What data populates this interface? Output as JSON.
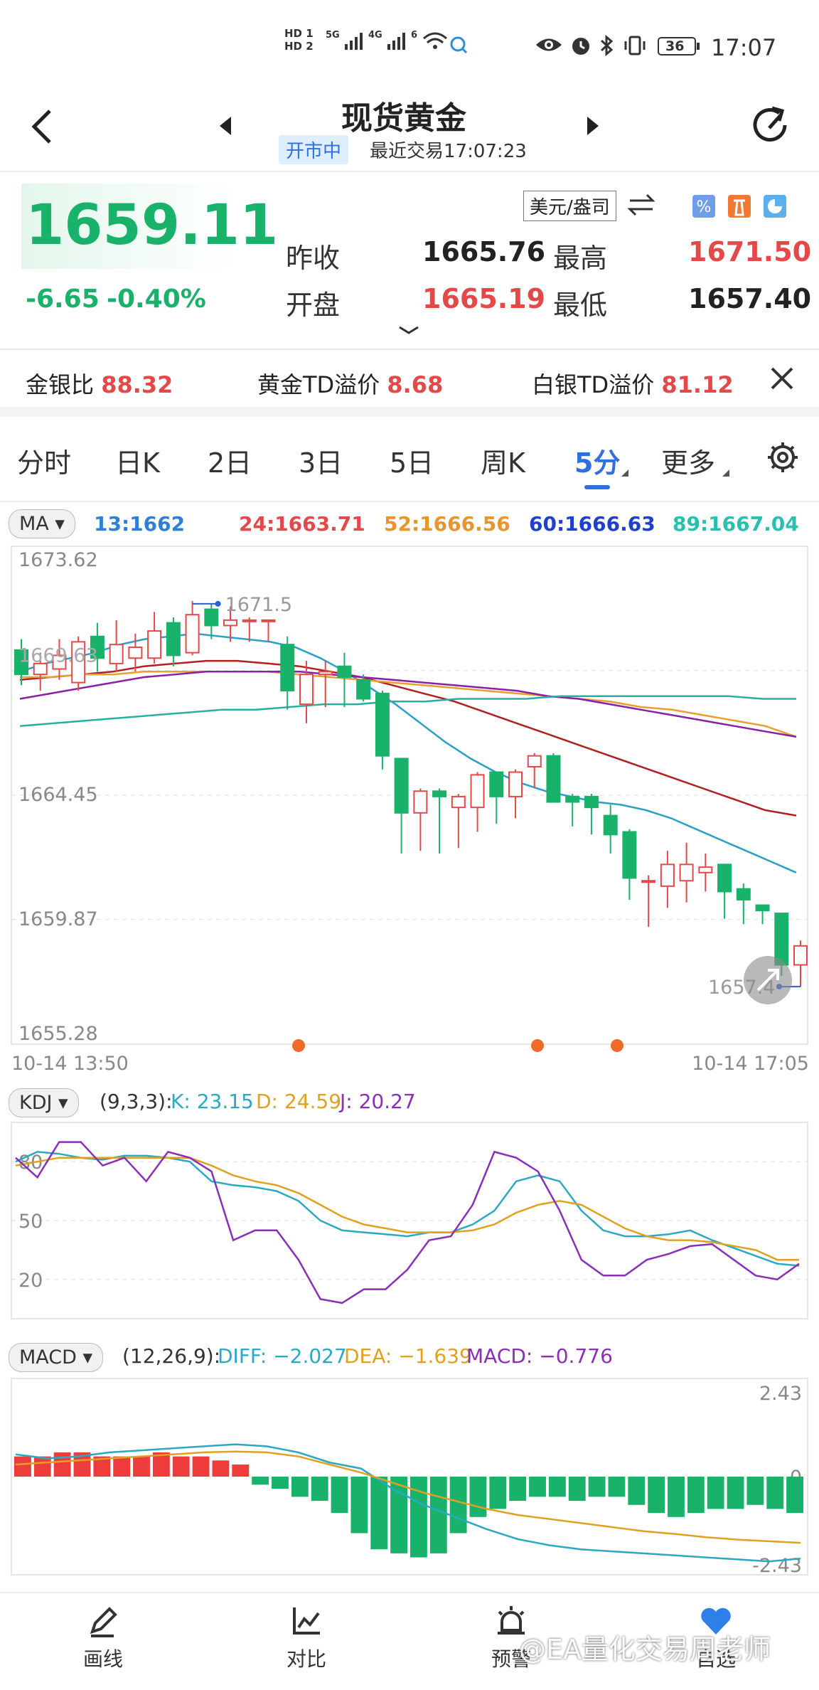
{
  "status_bar": {
    "hd1": "HD 1",
    "hd2": "HD 2",
    "net1": "5G",
    "net2": "4G",
    "net3": "6",
    "battery": "36",
    "time": "17:07"
  },
  "header": {
    "title": "现货黄金",
    "market_status": "开市中",
    "last_trade": "最近交易17:07:23"
  },
  "quote": {
    "price": "1659.11",
    "change": "-6.65",
    "change_pct": "-0.40%",
    "unit": "美元/盎司",
    "prev_close_label": "昨收",
    "prev_close": "1665.76",
    "high_label": "最高",
    "high": "1671.50",
    "open_label": "开盘",
    "open": "1665.19",
    "low_label": "最低",
    "low": "1657.40"
  },
  "ratios": {
    "gs_label": "金银比",
    "gs_value": "88.32",
    "gold_td_label": "黄金TD溢价",
    "gold_td_value": "8.68",
    "silver_td_label": "白银TD溢价",
    "silver_td_value": "81.12"
  },
  "tabs": [
    {
      "label": "分时"
    },
    {
      "label": "日K"
    },
    {
      "label": "2日"
    },
    {
      "label": "3日"
    },
    {
      "label": "5日"
    },
    {
      "label": "周K"
    },
    {
      "label": "5分",
      "active": true
    },
    {
      "label": "更多"
    }
  ],
  "ma": {
    "selector": "MA",
    "ma13": "13:1662",
    "ma24": "24:1663.71",
    "ma52": "52:1666.56",
    "ma60": "60:1666.63",
    "ma89": "89:1667.04"
  },
  "colors": {
    "up": "#e44949",
    "down": "#18b26b",
    "ma13": "#2aa0c8",
    "ma24": "#b0201f",
    "ma52": "#e5a030",
    "ma60": "#8a1fa8",
    "ma89": "#27b0a0"
  },
  "kdj": {
    "selector": "KDJ",
    "params": "(9,3,3):",
    "k": "K: 23.15",
    "d": "D: 24.59",
    "j": "J: 20.27"
  },
  "macd": {
    "selector": "MACD",
    "params": "(12,26,9):",
    "diff": "DIFF: −2.027",
    "dea": "DEA: −1.639",
    "macd": "MACD: −0.776"
  },
  "bottom_nav": [
    {
      "label": "画线"
    },
    {
      "label": "对比"
    },
    {
      "label": "预警"
    },
    {
      "label": "自选"
    }
  ],
  "watermark": "@EA量化交易周老师",
  "chart_data": [
    {
      "type": "candlestick",
      "title": "",
      "y_ticks": [
        "1673.62",
        "1664.45",
        "1659.87",
        "1655.28"
      ],
      "ylim": [
        1655.28,
        1673.62
      ],
      "x_labels": [
        "10-14 13:50",
        "10-14 17:05"
      ],
      "annotations": [
        {
          "text": "1671.5"
        },
        {
          "text": "1657.4"
        },
        {
          "text": "1669.63"
        }
      ],
      "candles": [
        [
          1669.8,
          1668.9,
          1670.2,
          1668.5
        ],
        [
          1668.9,
          1669.3,
          1669.7,
          1668.3
        ],
        [
          1669.1,
          1669.6,
          1670.2,
          1668.7
        ],
        [
          1668.6,
          1670.1,
          1670.3,
          1668.3
        ],
        [
          1670.3,
          1669.5,
          1670.8,
          1669.0
        ],
        [
          1669.3,
          1670.0,
          1670.9,
          1669.0
        ],
        [
          1669.5,
          1669.9,
          1670.4,
          1669.0
        ],
        [
          1669.5,
          1670.5,
          1671.2,
          1669.3
        ],
        [
          1670.8,
          1669.6,
          1671.0,
          1669.2
        ],
        [
          1669.7,
          1671.1,
          1671.6,
          1669.6
        ],
        [
          1671.3,
          1670.7,
          1671.5,
          1670.2
        ],
        [
          1670.7,
          1670.9,
          1671.4,
          1670.1
        ],
        [
          1670.9,
          1670.9,
          1671.0,
          1670.1
        ],
        [
          1670.9,
          1670.9,
          1670.9,
          1670.1
        ],
        [
          1670.0,
          1668.3,
          1670.3,
          1667.6
        ],
        [
          1667.8,
          1668.9,
          1669.4,
          1667.1
        ],
        [
          1668.9,
          1669.0,
          1669.4,
          1667.7
        ],
        [
          1669.2,
          1668.8,
          1669.7,
          1667.7
        ],
        [
          1668.7,
          1668.0,
          1668.9,
          1667.9
        ],
        [
          1668.2,
          1665.9,
          1668.3,
          1665.4
        ],
        [
          1665.8,
          1663.8,
          1665.4,
          1662.3
        ],
        [
          1663.8,
          1664.6,
          1664.7,
          1662.4
        ],
        [
          1664.6,
          1664.4,
          1664.7,
          1662.3
        ],
        [
          1664.0,
          1664.4,
          1664.5,
          1662.5
        ],
        [
          1664.0,
          1665.2,
          1665.3,
          1663.1
        ],
        [
          1665.3,
          1664.4,
          1665.2,
          1663.4
        ],
        [
          1664.4,
          1665.3,
          1665.4,
          1663.6
        ],
        [
          1665.5,
          1665.9,
          1666.0,
          1664.7
        ],
        [
          1665.9,
          1664.2,
          1666.0,
          1664.2
        ],
        [
          1664.4,
          1664.2,
          1664.5,
          1663.3
        ],
        [
          1664.4,
          1664.0,
          1664.5,
          1663.0
        ],
        [
          1663.7,
          1663.0,
          1664.1,
          1662.3
        ],
        [
          1663.1,
          1661.4,
          1663.2,
          1660.6
        ],
        [
          1661.3,
          1661.3,
          1661.5,
          1659.6
        ],
        [
          1661.1,
          1661.9,
          1662.4,
          1660.3
        ],
        [
          1661.3,
          1661.9,
          1662.7,
          1660.5
        ],
        [
          1661.6,
          1661.8,
          1662.3,
          1660.9
        ],
        [
          1661.9,
          1660.9,
          1661.9,
          1659.9
        ],
        [
          1661.0,
          1660.6,
          1661.2,
          1659.7
        ],
        [
          1660.4,
          1660.2,
          1660.4,
          1659.7
        ],
        [
          1660.1,
          1658.2,
          1660.0,
          1657.8
        ],
        [
          1658.2,
          1658.9,
          1659.1,
          1657.4
        ]
      ],
      "series": [
        {
          "name": "13",
          "values": [
            1669.0,
            1669.3,
            1669.5,
            1669.7,
            1670.0,
            1670.2,
            1670.3,
            1670.4,
            1670.3,
            1670.2,
            1670.1,
            1669.9,
            1669.5,
            1669.0,
            1668.4,
            1667.8,
            1667.1,
            1666.4,
            1665.8,
            1665.3,
            1664.9,
            1664.6,
            1664.4,
            1664.2,
            1664.1,
            1663.9,
            1663.6,
            1663.2,
            1662.8,
            1662.4,
            1662.0,
            1661.6
          ]
        },
        {
          "name": "24",
          "values": [
            1668.7,
            1668.8,
            1668.9,
            1669.0,
            1669.2,
            1669.3,
            1669.4,
            1669.4,
            1669.3,
            1669.2,
            1669.0,
            1668.8,
            1668.5,
            1668.2,
            1667.9,
            1667.5,
            1667.1,
            1666.7,
            1666.3,
            1665.9,
            1665.5,
            1665.1,
            1664.7,
            1664.3,
            1663.9,
            1663.7
          ]
        },
        {
          "name": "52",
          "values": [
            1668.8,
            1668.8,
            1668.9,
            1668.9,
            1669.0,
            1669.0,
            1669.0,
            1669.0,
            1669.0,
            1668.9,
            1668.8,
            1668.7,
            1668.6,
            1668.5,
            1668.4,
            1668.3,
            1668.2,
            1668.1,
            1668.0,
            1667.9,
            1667.7,
            1667.6,
            1667.4,
            1667.2,
            1667.0,
            1666.6
          ]
        },
        {
          "name": "60",
          "values": [
            1668.0,
            1668.2,
            1668.4,
            1668.6,
            1668.8,
            1668.9,
            1669.0,
            1669.0,
            1669.0,
            1669.0,
            1668.9,
            1668.8,
            1668.7,
            1668.6,
            1668.5,
            1668.4,
            1668.3,
            1668.1,
            1668.0,
            1667.8,
            1667.6,
            1667.4,
            1667.2,
            1667.0,
            1666.8,
            1666.6
          ]
        },
        {
          "name": "89",
          "values": [
            1667.0,
            1667.1,
            1667.2,
            1667.3,
            1667.4,
            1667.5,
            1667.6,
            1667.6,
            1667.7,
            1667.8,
            1667.8,
            1667.9,
            1667.9,
            1668.0,
            1668.0,
            1668.0,
            1668.1,
            1668.1,
            1668.1,
            1668.1,
            1668.1,
            1668.1,
            1668.0,
            1668.0
          ]
        }
      ]
    },
    {
      "type": "line",
      "title": "KDJ",
      "y_ticks": [
        "80",
        "50",
        "20"
      ],
      "ylim": [
        0,
        100
      ],
      "series": [
        {
          "name": "K",
          "values": [
            80,
            85,
            84,
            82,
            81,
            83,
            83,
            82,
            80,
            70,
            68,
            67,
            65,
            60,
            50,
            45,
            44,
            43,
            42,
            44,
            44,
            48,
            55,
            70,
            73,
            70,
            55,
            45,
            42,
            42,
            43,
            45,
            40,
            36,
            32,
            28,
            27
          ]
        },
        {
          "name": "D",
          "values": [
            78,
            80,
            82,
            82,
            82,
            82,
            82,
            82,
            82,
            78,
            73,
            70,
            68,
            64,
            58,
            52,
            48,
            46,
            44,
            44,
            44,
            45,
            48,
            54,
            58,
            60,
            58,
            52,
            46,
            42,
            40,
            40,
            39,
            37,
            35,
            30,
            30
          ]
        },
        {
          "name": "J",
          "values": [
            82,
            72,
            90,
            90,
            78,
            82,
            70,
            85,
            82,
            75,
            40,
            45,
            45,
            30,
            10,
            8,
            15,
            15,
            25,
            40,
            42,
            58,
            85,
            82,
            75,
            55,
            30,
            22,
            22,
            30,
            33,
            37,
            38,
            30,
            22,
            20,
            28
          ]
        }
      ]
    },
    {
      "type": "bar",
      "title": "MACD",
      "y_ticks": [
        "2.43",
        "0",
        "-2.43"
      ],
      "ylim": [
        -2.43,
        2.43
      ],
      "values": [
        0.5,
        0.5,
        0.6,
        0.6,
        0.5,
        0.5,
        0.5,
        0.6,
        0.5,
        0.5,
        0.4,
        0.3,
        -0.2,
        -0.3,
        -0.5,
        -0.6,
        -0.9,
        -1.4,
        -1.8,
        -1.9,
        -2.0,
        -1.9,
        -1.4,
        -1.0,
        -0.8,
        -0.6,
        -0.5,
        -0.5,
        -0.6,
        -0.5,
        -0.5,
        -0.7,
        -0.9,
        -1.0,
        -0.9,
        -0.8,
        -0.8,
        -0.7,
        -0.8,
        -0.9
      ]
    }
  ]
}
